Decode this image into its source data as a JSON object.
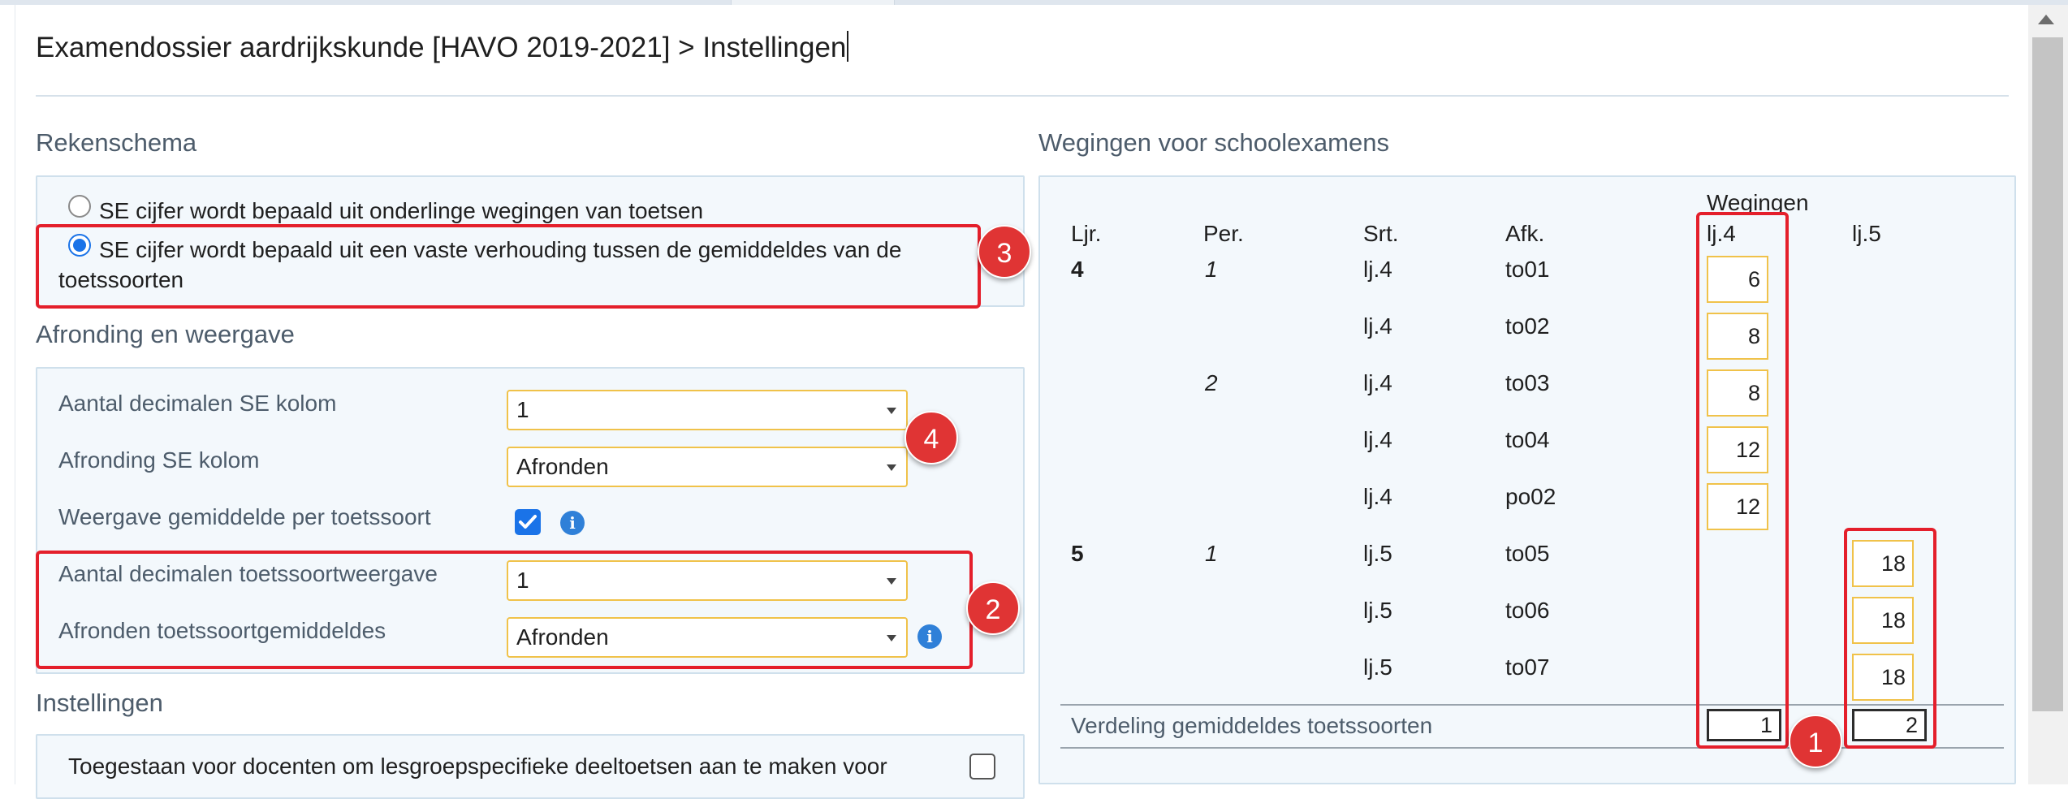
{
  "page": {
    "title": "Examendossier aardrijkskunde [HAVO 2019-2021] > Instellingen"
  },
  "rekenschema": {
    "heading": "Rekenschema",
    "option1": "SE cijfer wordt bepaald uit onderlinge wegingen van toetsen",
    "option2_line1": "SE cijfer wordt bepaald uit een vaste verhouding tussen de gemiddeldes van de",
    "option2_line2": "toetssoorten",
    "selected": 2
  },
  "afronding": {
    "heading": "Afronding en weergave",
    "decimalen_se_label": "Aantal decimalen SE kolom",
    "decimalen_se_value": "1",
    "afronding_se_label": "Afronding SE kolom",
    "afronding_se_value": "Afronden",
    "weergave_label": "Weergave gemiddelde per toetssoort",
    "weergave_checked": true,
    "decimalen_toets_label": "Aantal decimalen toetssoortweergave",
    "decimalen_toets_value": "1",
    "afronden_toets_label": "Afronden toetssoortgemiddeldes",
    "afronden_toets_value": "Afronden"
  },
  "instellingen": {
    "heading": "Instellingen",
    "toegestaan_label": "Toegestaan voor docenten om lesgroepspecifieke deeltoetsen aan te maken voor",
    "toegestaan_checked": false
  },
  "wegingen": {
    "heading": "Wegingen voor schoolexamens",
    "col_ljr": "Ljr.",
    "col_per": "Per.",
    "col_srt": "Srt.",
    "col_afk": "Afk.",
    "col_wegingen": "Wegingen",
    "col_lj4": "lj.4",
    "col_lj5": "lj.5",
    "rows": [
      {
        "ljr": "4",
        "per": "1",
        "srt": "lj.4",
        "afk": "to01",
        "lj4": "6",
        "lj5": ""
      },
      {
        "ljr": "",
        "per": "",
        "srt": "lj.4",
        "afk": "to02",
        "lj4": "8",
        "lj5": ""
      },
      {
        "ljr": "",
        "per": "2",
        "srt": "lj.4",
        "afk": "to03",
        "lj4": "8",
        "lj5": ""
      },
      {
        "ljr": "",
        "per": "",
        "srt": "lj.4",
        "afk": "to04",
        "lj4": "12",
        "lj5": ""
      },
      {
        "ljr": "",
        "per": "",
        "srt": "lj.4",
        "afk": "po02",
        "lj4": "12",
        "lj5": ""
      },
      {
        "ljr": "5",
        "per": "1",
        "srt": "lj.5",
        "afk": "to05",
        "lj4": "",
        "lj5": "18"
      },
      {
        "ljr": "",
        "per": "",
        "srt": "lj.5",
        "afk": "to06",
        "lj4": "",
        "lj5": "18"
      },
      {
        "ljr": "",
        "per": "",
        "srt": "lj.5",
        "afk": "to07",
        "lj4": "",
        "lj5": "18"
      }
    ],
    "verdeling_label": "Verdeling gemiddeldes toetssoorten",
    "verdeling_lj4": "1",
    "verdeling_lj5": "2"
  },
  "annotations": {
    "badge1": "1",
    "badge2": "2",
    "badge3": "3",
    "badge4": "4",
    "color": "#e41f2b"
  }
}
